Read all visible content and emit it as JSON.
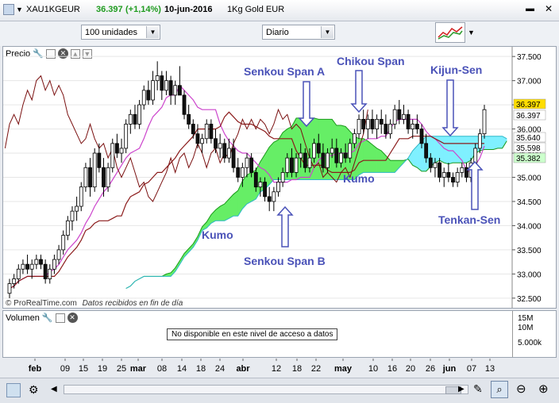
{
  "header": {
    "symbol": "XAU1KGEUR",
    "price": "36.397",
    "change": "(+1,14%)",
    "date": "10-jun-2016",
    "name": "1Kg Gold EUR"
  },
  "toolbar": {
    "units": "100 unidades",
    "period": "Diario"
  },
  "price_panel": {
    "title": "Precio",
    "watermark": "© ProRealTime.com",
    "watermark_note": "Datos recibidos en fin de día"
  },
  "volume_panel": {
    "title": "Volumen",
    "message": "No disponible en este nivel de acceso a datos",
    "axis_labels": [
      "15M",
      "10M",
      "5.000k"
    ]
  },
  "colors": {
    "up_candle": "#ffffff",
    "down_candle": "#111111",
    "tenkan": "#cc44cc",
    "kijun": "#8b1a1a",
    "chikou": "#7a1010",
    "kumo_bull": "#66ee66",
    "kumo_bear": "#7ff0ff",
    "annotation": "#4a52b8"
  },
  "chart_data": {
    "type": "line",
    "subtype": "candlestick with Ichimoku indicator",
    "ylim": [
      32.3,
      37.7
    ],
    "y_ticks": [
      "37.500",
      "37.000",
      "36.500",
      "36.000",
      "35.500",
      "35.000",
      "34.500",
      "34.000",
      "33.500",
      "33.000",
      "32.500"
    ],
    "x_ticks": [
      "feb",
      "09",
      "15",
      "19",
      "25",
      "mar",
      "08",
      "14",
      "18",
      "24",
      "abr",
      "12",
      "18",
      "22",
      "may",
      "10",
      "16",
      "20",
      "26",
      "jun",
      "07",
      "13"
    ],
    "price_labels": [
      {
        "value": "36.397",
        "color": "#ffdd00"
      },
      {
        "value": "36.397",
        "color": "#ffffff"
      },
      {
        "value": "35.640",
        "color": "#ffffff"
      },
      {
        "value": "35.598",
        "color": "#ffffff"
      },
      {
        "value": "35.382",
        "color": "#ccffcc"
      }
    ],
    "annotations": [
      "Senkou Span A",
      "Chikou Span",
      "Kijun-Sen",
      "Kumo",
      "Kumo",
      "Senkou Span B",
      "Tenkan-Sen"
    ],
    "candles": [
      [
        32.6,
        32.9,
        32.5,
        32.8
      ],
      [
        32.8,
        33.0,
        32.7,
        32.9
      ],
      [
        32.9,
        33.2,
        32.8,
        33.1
      ],
      [
        33.1,
        33.3,
        33.0,
        33.2
      ],
      [
        33.2,
        33.4,
        33.0,
        33.1
      ],
      [
        33.1,
        33.3,
        32.9,
        33.2
      ],
      [
        33.2,
        33.4,
        33.1,
        33.3
      ],
      [
        33.3,
        33.4,
        33.1,
        33.2
      ],
      [
        33.2,
        33.3,
        32.8,
        32.9
      ],
      [
        32.9,
        33.2,
        32.8,
        33.1
      ],
      [
        33.1,
        33.4,
        33.0,
        33.3
      ],
      [
        33.3,
        33.6,
        33.2,
        33.5
      ],
      [
        33.5,
        33.9,
        33.4,
        33.8
      ],
      [
        33.8,
        34.2,
        33.7,
        34.1
      ],
      [
        34.1,
        34.4,
        33.9,
        34.3
      ],
      [
        34.3,
        34.6,
        34.1,
        34.4
      ],
      [
        34.4,
        34.9,
        34.3,
        34.8
      ],
      [
        34.8,
        35.3,
        34.7,
        35.2
      ],
      [
        35.2,
        35.4,
        34.6,
        34.8
      ],
      [
        34.8,
        35.6,
        34.7,
        35.5
      ],
      [
        35.5,
        35.7,
        35.1,
        35.2
      ],
      [
        35.2,
        35.4,
        34.6,
        34.8
      ],
      [
        34.8,
        35.3,
        34.7,
        35.2
      ],
      [
        35.2,
        35.8,
        35.1,
        35.7
      ],
      [
        35.7,
        35.9,
        35.4,
        35.5
      ],
      [
        35.5,
        35.8,
        35.3,
        35.6
      ],
      [
        35.6,
        36.2,
        35.5,
        36.1
      ],
      [
        36.1,
        36.4,
        35.9,
        36.3
      ],
      [
        36.3,
        36.5,
        36.0,
        36.1
      ],
      [
        36.1,
        36.6,
        36.0,
        36.5
      ],
      [
        36.5,
        36.9,
        36.4,
        36.8
      ],
      [
        36.8,
        37.0,
        36.5,
        36.6
      ],
      [
        36.6,
        37.2,
        36.5,
        37.0
      ],
      [
        37.0,
        37.4,
        36.8,
        37.1
      ],
      [
        37.1,
        37.2,
        36.6,
        36.8
      ],
      [
        36.8,
        37.2,
        36.7,
        37.0
      ],
      [
        37.0,
        37.1,
        36.5,
        36.7
      ],
      [
        36.7,
        37.0,
        36.5,
        36.9
      ],
      [
        36.9,
        37.3,
        36.7,
        36.7
      ],
      [
        36.7,
        36.8,
        36.2,
        36.3
      ],
      [
        36.3,
        36.5,
        36.0,
        36.1
      ],
      [
        36.1,
        36.2,
        35.8,
        35.9
      ],
      [
        35.9,
        36.1,
        35.6,
        35.7
      ],
      [
        35.7,
        35.9,
        35.5,
        35.8
      ],
      [
        35.8,
        36.2,
        35.7,
        36.1
      ],
      [
        36.1,
        36.2,
        35.7,
        35.8
      ],
      [
        35.8,
        36.0,
        35.5,
        35.6
      ],
      [
        35.6,
        35.9,
        35.4,
        35.7
      ],
      [
        35.7,
        35.8,
        35.3,
        35.4
      ],
      [
        35.4,
        35.8,
        35.3,
        35.6
      ],
      [
        35.6,
        35.8,
        35.1,
        35.2
      ],
      [
        35.2,
        35.4,
        34.9,
        35.0
      ],
      [
        35.0,
        35.3,
        34.8,
        35.2
      ],
      [
        35.2,
        35.5,
        35.0,
        35.4
      ],
      [
        35.4,
        35.5,
        35.0,
        35.1
      ],
      [
        35.1,
        35.2,
        34.7,
        34.8
      ],
      [
        34.8,
        35.0,
        34.6,
        34.9
      ],
      [
        34.9,
        35.0,
        34.5,
        34.6
      ],
      [
        34.6,
        34.8,
        34.3,
        34.5
      ],
      [
        34.5,
        34.8,
        34.3,
        34.7
      ],
      [
        34.7,
        35.0,
        34.6,
        34.9
      ],
      [
        34.9,
        35.2,
        34.8,
        35.1
      ],
      [
        35.1,
        35.5,
        35.0,
        35.4
      ],
      [
        35.4,
        35.6,
        35.0,
        35.1
      ],
      [
        35.1,
        35.5,
        35.0,
        35.4
      ],
      [
        35.4,
        35.7,
        35.2,
        35.5
      ],
      [
        35.5,
        35.6,
        35.1,
        35.2
      ],
      [
        35.2,
        35.6,
        35.1,
        35.4
      ],
      [
        35.4,
        35.8,
        35.3,
        35.7
      ],
      [
        35.7,
        35.9,
        35.4,
        35.5
      ],
      [
        35.5,
        35.7,
        35.1,
        35.2
      ],
      [
        35.2,
        35.6,
        35.1,
        35.5
      ],
      [
        35.5,
        35.8,
        35.4,
        35.6
      ],
      [
        35.6,
        35.8,
        35.2,
        35.3
      ],
      [
        35.3,
        35.6,
        35.2,
        35.5
      ],
      [
        35.5,
        35.7,
        35.3,
        35.4
      ],
      [
        35.4,
        35.8,
        35.3,
        35.7
      ],
      [
        35.7,
        36.0,
        35.6,
        35.9
      ],
      [
        35.9,
        36.3,
        35.8,
        36.2
      ],
      [
        36.2,
        36.4,
        35.9,
        36.0
      ],
      [
        36.0,
        36.3,
        35.8,
        36.2
      ],
      [
        36.2,
        36.4,
        35.9,
        36.0
      ],
      [
        36.0,
        36.3,
        35.8,
        36.2
      ],
      [
        36.2,
        36.4,
        35.9,
        36.1
      ],
      [
        36.1,
        36.3,
        35.8,
        35.9
      ],
      [
        35.9,
        36.2,
        35.8,
        36.1
      ],
      [
        36.1,
        36.5,
        36.0,
        36.4
      ],
      [
        36.4,
        36.6,
        36.1,
        36.2
      ],
      [
        36.2,
        36.5,
        36.1,
        36.3
      ],
      [
        36.3,
        36.4,
        35.9,
        36.0
      ],
      [
        36.0,
        36.2,
        35.8,
        36.1
      ],
      [
        36.1,
        36.3,
        35.9,
        36.0
      ],
      [
        36.0,
        36.1,
        35.6,
        35.7
      ],
      [
        35.7,
        35.9,
        35.3,
        35.4
      ],
      [
        35.4,
        35.5,
        35.1,
        35.2
      ],
      [
        35.2,
        35.4,
        35.0,
        35.3
      ],
      [
        35.3,
        35.4,
        34.9,
        35.0
      ],
      [
        35.0,
        35.2,
        34.8,
        35.1
      ],
      [
        35.1,
        35.3,
        34.9,
        35.0
      ],
      [
        35.0,
        35.1,
        34.8,
        34.9
      ],
      [
        34.9,
        35.2,
        34.8,
        35.1
      ],
      [
        35.1,
        35.3,
        35.0,
        35.2
      ],
      [
        35.2,
        35.3,
        34.9,
        35.0
      ],
      [
        35.0,
        35.4,
        34.9,
        35.3
      ],
      [
        35.3,
        35.7,
        35.2,
        35.6
      ],
      [
        35.6,
        36.0,
        35.5,
        35.9
      ],
      [
        35.9,
        36.5,
        35.8,
        36.4
      ]
    ]
  }
}
